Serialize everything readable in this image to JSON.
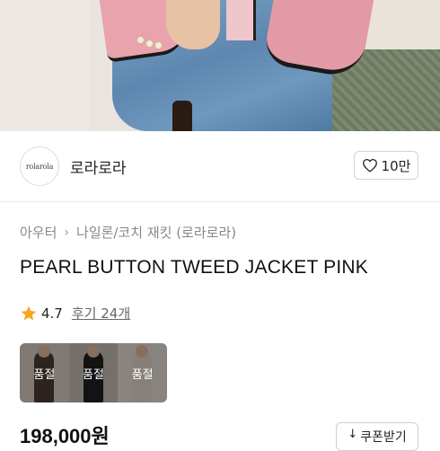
{
  "brand": {
    "logo_text": "rolarola",
    "name": "로라로라",
    "like_count": "10만"
  },
  "breadcrumb": {
    "items": [
      "아우터",
      "나일론/코치 재킷 (로라로라)"
    ]
  },
  "product": {
    "title": "PEARL BUTTON TWEED JACKET PINK",
    "rating": "4.7",
    "reviews_label": "후기 24개",
    "price": "198,000원"
  },
  "variants": [
    {
      "status": "품절",
      "color": "#4a3a33"
    },
    {
      "status": "품절",
      "color": "#1f1f1f"
    },
    {
      "status": "품절",
      "color": "#d8cfc4"
    }
  ],
  "coupon": {
    "label": "쿠폰받기",
    "icon": "download-arrow-icon"
  },
  "colors": {
    "star": "#f5a623",
    "border": "#d4d4d4"
  }
}
